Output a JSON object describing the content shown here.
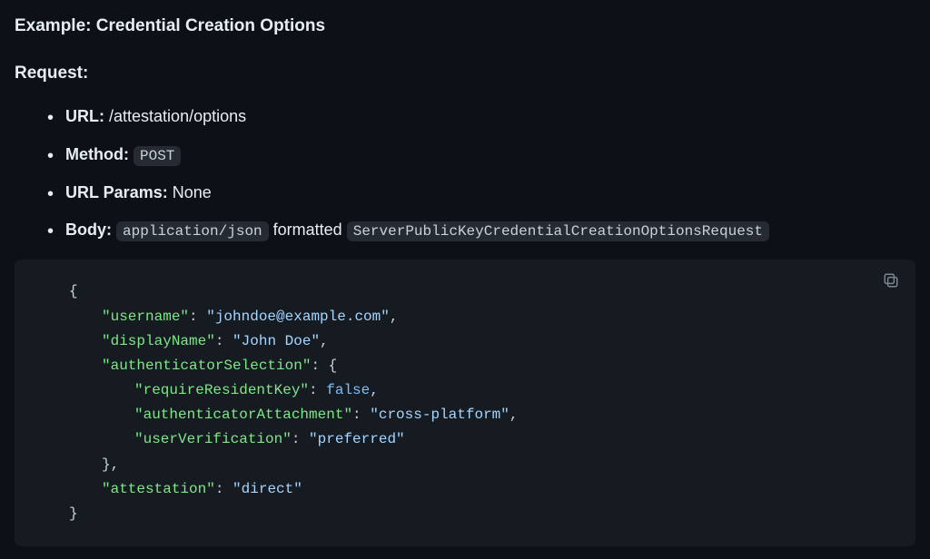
{
  "heading": "Example: Credential Creation Options",
  "request_label": "Request:",
  "list": {
    "url_label": "URL:",
    "url_value": "/attestation/options",
    "method_label": "Method:",
    "method_value": "POST",
    "url_params_label": "URL Params:",
    "url_params_value": "None",
    "body_label": "Body:",
    "body_mime": "application/json",
    "body_formatted": "formatted",
    "body_type": "ServerPublicKeyCredentialCreationOptionsRequest"
  },
  "code": {
    "brace_open": "{",
    "brace_close": "}",
    "comma": ",",
    "colon_brace": ": {",
    "brace_close_comma": "},",
    "k_username": "\"username\"",
    "v_username": "\"johndoe@example.com\"",
    "k_displayName": "\"displayName\"",
    "v_displayName": "\"John Doe\"",
    "k_authsel": "\"authenticatorSelection\"",
    "k_rrk": "\"requireResidentKey\"",
    "v_rrk": "false",
    "k_aa": "\"authenticatorAttachment\"",
    "v_aa": "\"cross-platform\"",
    "k_uv": "\"userVerification\"",
    "v_uv": "\"preferred\"",
    "k_att": "\"attestation\"",
    "v_att": "\"direct\"",
    "sep": ": "
  }
}
